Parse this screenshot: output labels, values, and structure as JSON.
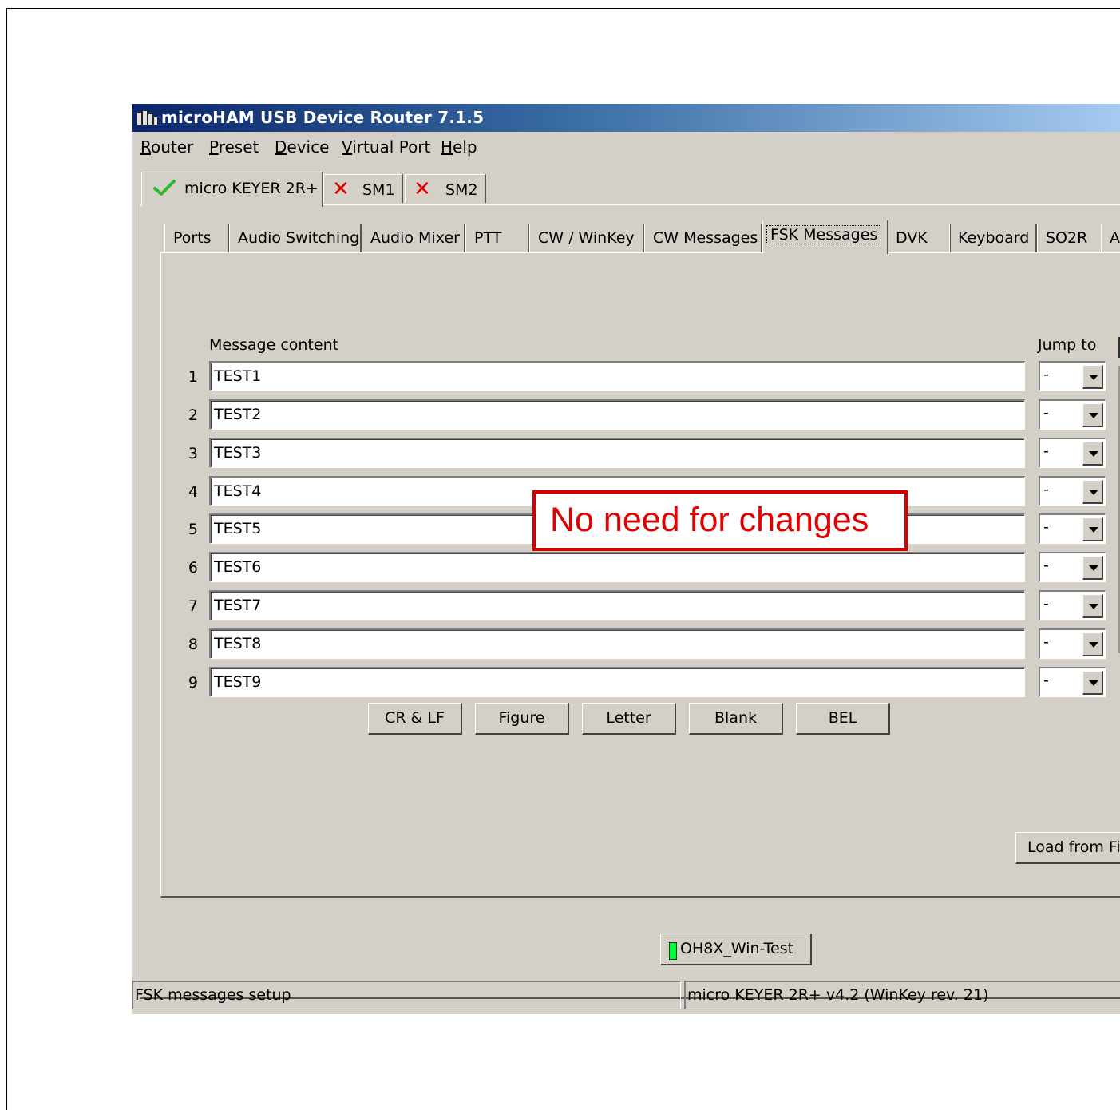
{
  "window": {
    "title": "microHAM USB Device Router 7.1.5"
  },
  "menu": [
    "Router",
    "Preset",
    "Device",
    "Virtual Port",
    "Help"
  ],
  "device_tabs": [
    {
      "label": "micro KEYER 2R+",
      "status": "ok"
    },
    {
      "label": "SM1",
      "status": "error"
    },
    {
      "label": "SM2",
      "status": "error"
    }
  ],
  "sub_tabs": [
    "Ports",
    "Audio Switching",
    "Audio Mixer",
    "PTT",
    "CW / WinKey",
    "CW Messages",
    "FSK Messages",
    "DVK",
    "Keyboard",
    "SO2R",
    "A"
  ],
  "active_sub_tab": "FSK Messages",
  "fsk": {
    "message_header": "Message content",
    "jump_header": "Jump to",
    "messages": [
      {
        "num": "1",
        "value": "TEST1",
        "jump": "-"
      },
      {
        "num": "2",
        "value": "TEST2",
        "jump": "-"
      },
      {
        "num": "3",
        "value": "TEST3",
        "jump": "-"
      },
      {
        "num": "4",
        "value": "TEST4",
        "jump": "-"
      },
      {
        "num": "5",
        "value": "TEST5",
        "jump": "-"
      },
      {
        "num": "6",
        "value": "TEST6",
        "jump": "-"
      },
      {
        "num": "7",
        "value": "TEST7",
        "jump": "-"
      },
      {
        "num": "8",
        "value": "TEST8",
        "jump": "-"
      },
      {
        "num": "9",
        "value": "TEST9",
        "jump": "-"
      }
    ],
    "buttons": [
      "CR & LF",
      "Figure",
      "Letter",
      "Blank",
      "BEL"
    ],
    "load_button": "Load from Fi"
  },
  "annotation": "No need for changes",
  "preset_button": "OH8X_Win-Test",
  "status": {
    "left": "FSK messages setup",
    "right": "micro KEYER 2R+ v4.2 (WinKey rev. 21)"
  },
  "colors": {
    "annotation": "#e00000",
    "title_start": "#0a246a",
    "led": "#00ff40"
  }
}
